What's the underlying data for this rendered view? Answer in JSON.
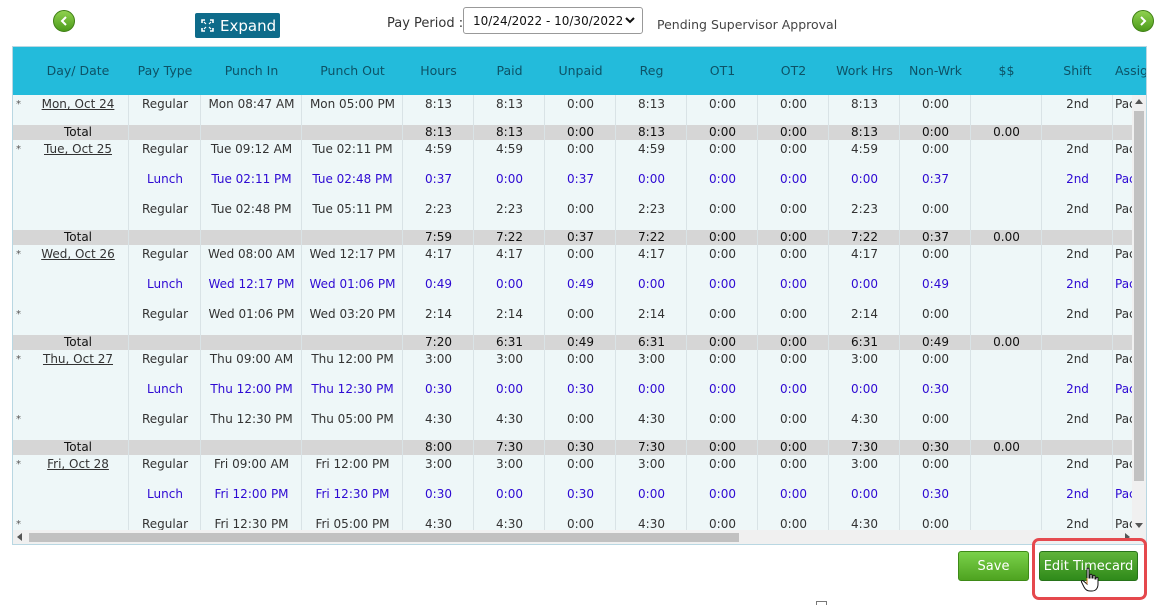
{
  "toolbar": {
    "expand_label": "Expand",
    "pay_period_label": "Pay Period :",
    "pay_period_value": "10/24/2022 - 10/30/2022",
    "status": "Pending Supervisor Approval"
  },
  "columns": [
    "Day/ Date",
    "Pay Type",
    "Punch In",
    "Punch Out",
    "Hours",
    "Paid",
    "Unpaid",
    "Reg",
    "OT1",
    "OT2",
    "Work Hrs",
    "Non-Wrk",
    "$$",
    "Shift",
    "Assignme"
  ],
  "days": [
    {
      "date": "Mon, Oct 24",
      "entries": [
        {
          "star": "*",
          "type": "Regular",
          "in": "Mon 08:47 AM",
          "out": "Mon 05:00 PM",
          "hours": "8:13",
          "paid": "8:13",
          "unpaid": "0:00",
          "reg": "8:13",
          "ot1": "0:00",
          "ot2": "0:00",
          "work": "8:13",
          "nonwrk": "0:00",
          "money": "",
          "shift": "2nd",
          "assign": "Pac"
        }
      ],
      "total": {
        "label": "Total",
        "hours": "8:13",
        "paid": "8:13",
        "unpaid": "0:00",
        "reg": "8:13",
        "ot1": "0:00",
        "ot2": "0:00",
        "work": "8:13",
        "nonwrk": "0:00",
        "money": "0.00"
      }
    },
    {
      "date": "Tue, Oct 25",
      "entries": [
        {
          "star": "*",
          "type": "Regular",
          "in": "Tue 09:12 AM",
          "out": "Tue 02:11 PM",
          "hours": "4:59",
          "paid": "4:59",
          "unpaid": "0:00",
          "reg": "4:59",
          "ot1": "0:00",
          "ot2": "0:00",
          "work": "4:59",
          "nonwrk": "0:00",
          "money": "",
          "shift": "2nd",
          "assign": "Pac"
        },
        {
          "star": "",
          "type": "Lunch",
          "in": "Tue 02:11 PM",
          "out": "Tue 02:48 PM",
          "hours": "0:37",
          "paid": "0:00",
          "unpaid": "0:37",
          "reg": "0:00",
          "ot1": "0:00",
          "ot2": "0:00",
          "work": "0:00",
          "nonwrk": "0:37",
          "money": "",
          "shift": "2nd",
          "assign": "Pac"
        },
        {
          "star": "",
          "type": "Regular",
          "in": "Tue 02:48 PM",
          "out": "Tue 05:11 PM",
          "hours": "2:23",
          "paid": "2:23",
          "unpaid": "0:00",
          "reg": "2:23",
          "ot1": "0:00",
          "ot2": "0:00",
          "work": "2:23",
          "nonwrk": "0:00",
          "money": "",
          "shift": "2nd",
          "assign": "Pac"
        }
      ],
      "total": {
        "label": "Total",
        "hours": "7:59",
        "paid": "7:22",
        "unpaid": "0:37",
        "reg": "7:22",
        "ot1": "0:00",
        "ot2": "0:00",
        "work": "7:22",
        "nonwrk": "0:37",
        "money": "0.00"
      }
    },
    {
      "date": "Wed, Oct 26",
      "entries": [
        {
          "star": "*",
          "type": "Regular",
          "in": "Wed 08:00 AM",
          "out": "Wed 12:17 PM",
          "hours": "4:17",
          "paid": "4:17",
          "unpaid": "0:00",
          "reg": "4:17",
          "ot1": "0:00",
          "ot2": "0:00",
          "work": "4:17",
          "nonwrk": "0:00",
          "money": "",
          "shift": "2nd",
          "assign": "Pac"
        },
        {
          "star": "",
          "type": "Lunch",
          "in": "Wed 12:17 PM",
          "out": "Wed 01:06 PM",
          "hours": "0:49",
          "paid": "0:00",
          "unpaid": "0:49",
          "reg": "0:00",
          "ot1": "0:00",
          "ot2": "0:00",
          "work": "0:00",
          "nonwrk": "0:49",
          "money": "",
          "shift": "2nd",
          "assign": "Pac"
        },
        {
          "star": "*",
          "type": "Regular",
          "in": "Wed 01:06 PM",
          "out": "Wed 03:20 PM",
          "hours": "2:14",
          "paid": "2:14",
          "unpaid": "0:00",
          "reg": "2:14",
          "ot1": "0:00",
          "ot2": "0:00",
          "work": "2:14",
          "nonwrk": "0:00",
          "money": "",
          "shift": "2nd",
          "assign": "Pac"
        }
      ],
      "total": {
        "label": "Total",
        "hours": "7:20",
        "paid": "6:31",
        "unpaid": "0:49",
        "reg": "6:31",
        "ot1": "0:00",
        "ot2": "0:00",
        "work": "6:31",
        "nonwrk": "0:49",
        "money": "0.00"
      }
    },
    {
      "date": "Thu, Oct 27",
      "entries": [
        {
          "star": "*",
          "type": "Regular",
          "in": "Thu 09:00 AM",
          "out": "Thu 12:00 PM",
          "hours": "3:00",
          "paid": "3:00",
          "unpaid": "0:00",
          "reg": "3:00",
          "ot1": "0:00",
          "ot2": "0:00",
          "work": "3:00",
          "nonwrk": "0:00",
          "money": "",
          "shift": "2nd",
          "assign": "Pac"
        },
        {
          "star": "",
          "type": "Lunch",
          "in": "Thu 12:00 PM",
          "out": "Thu 12:30 PM",
          "hours": "0:30",
          "paid": "0:00",
          "unpaid": "0:30",
          "reg": "0:00",
          "ot1": "0:00",
          "ot2": "0:00",
          "work": "0:00",
          "nonwrk": "0:30",
          "money": "",
          "shift": "2nd",
          "assign": "Pac"
        },
        {
          "star": "*",
          "type": "Regular",
          "in": "Thu 12:30 PM",
          "out": "Thu 05:00 PM",
          "hours": "4:30",
          "paid": "4:30",
          "unpaid": "0:00",
          "reg": "4:30",
          "ot1": "0:00",
          "ot2": "0:00",
          "work": "4:30",
          "nonwrk": "0:00",
          "money": "",
          "shift": "2nd",
          "assign": "Pac"
        }
      ],
      "total": {
        "label": "Total",
        "hours": "8:00",
        "paid": "7:30",
        "unpaid": "0:30",
        "reg": "7:30",
        "ot1": "0:00",
        "ot2": "0:00",
        "work": "7:30",
        "nonwrk": "0:30",
        "money": "0.00"
      }
    },
    {
      "date": "Fri, Oct 28",
      "entries": [
        {
          "star": "*",
          "type": "Regular",
          "in": "Fri 09:00 AM",
          "out": "Fri 12:00 PM",
          "hours": "3:00",
          "paid": "3:00",
          "unpaid": "0:00",
          "reg": "3:00",
          "ot1": "0:00",
          "ot2": "0:00",
          "work": "3:00",
          "nonwrk": "0:00",
          "money": "",
          "shift": "2nd",
          "assign": "Pac"
        },
        {
          "star": "",
          "type": "Lunch",
          "in": "Fri 12:00 PM",
          "out": "Fri 12:30 PM",
          "hours": "0:30",
          "paid": "0:00",
          "unpaid": "0:30",
          "reg": "0:00",
          "ot1": "0:00",
          "ot2": "0:00",
          "work": "0:00",
          "nonwrk": "0:30",
          "money": "",
          "shift": "2nd",
          "assign": "Pac"
        },
        {
          "star": "*",
          "type": "Regular",
          "in": "Fri 12:30 PM",
          "out": "Fri 05:00 PM",
          "hours": "4:30",
          "paid": "4:30",
          "unpaid": "0:00",
          "reg": "4:30",
          "ot1": "0:00",
          "ot2": "0:00",
          "work": "4:30",
          "nonwrk": "0:00",
          "money": "",
          "shift": "2nd",
          "assign": "Pac"
        }
      ]
    }
  ],
  "actions": {
    "save_label": "Save",
    "edit_label": "Edit Timecard"
  },
  "colors": {
    "header": "#23bbdb",
    "lunch_text": "#2e0ad3",
    "total_row": "#d6d6d6",
    "highlight": "#e5484d",
    "save_button": "#5cb82f"
  }
}
